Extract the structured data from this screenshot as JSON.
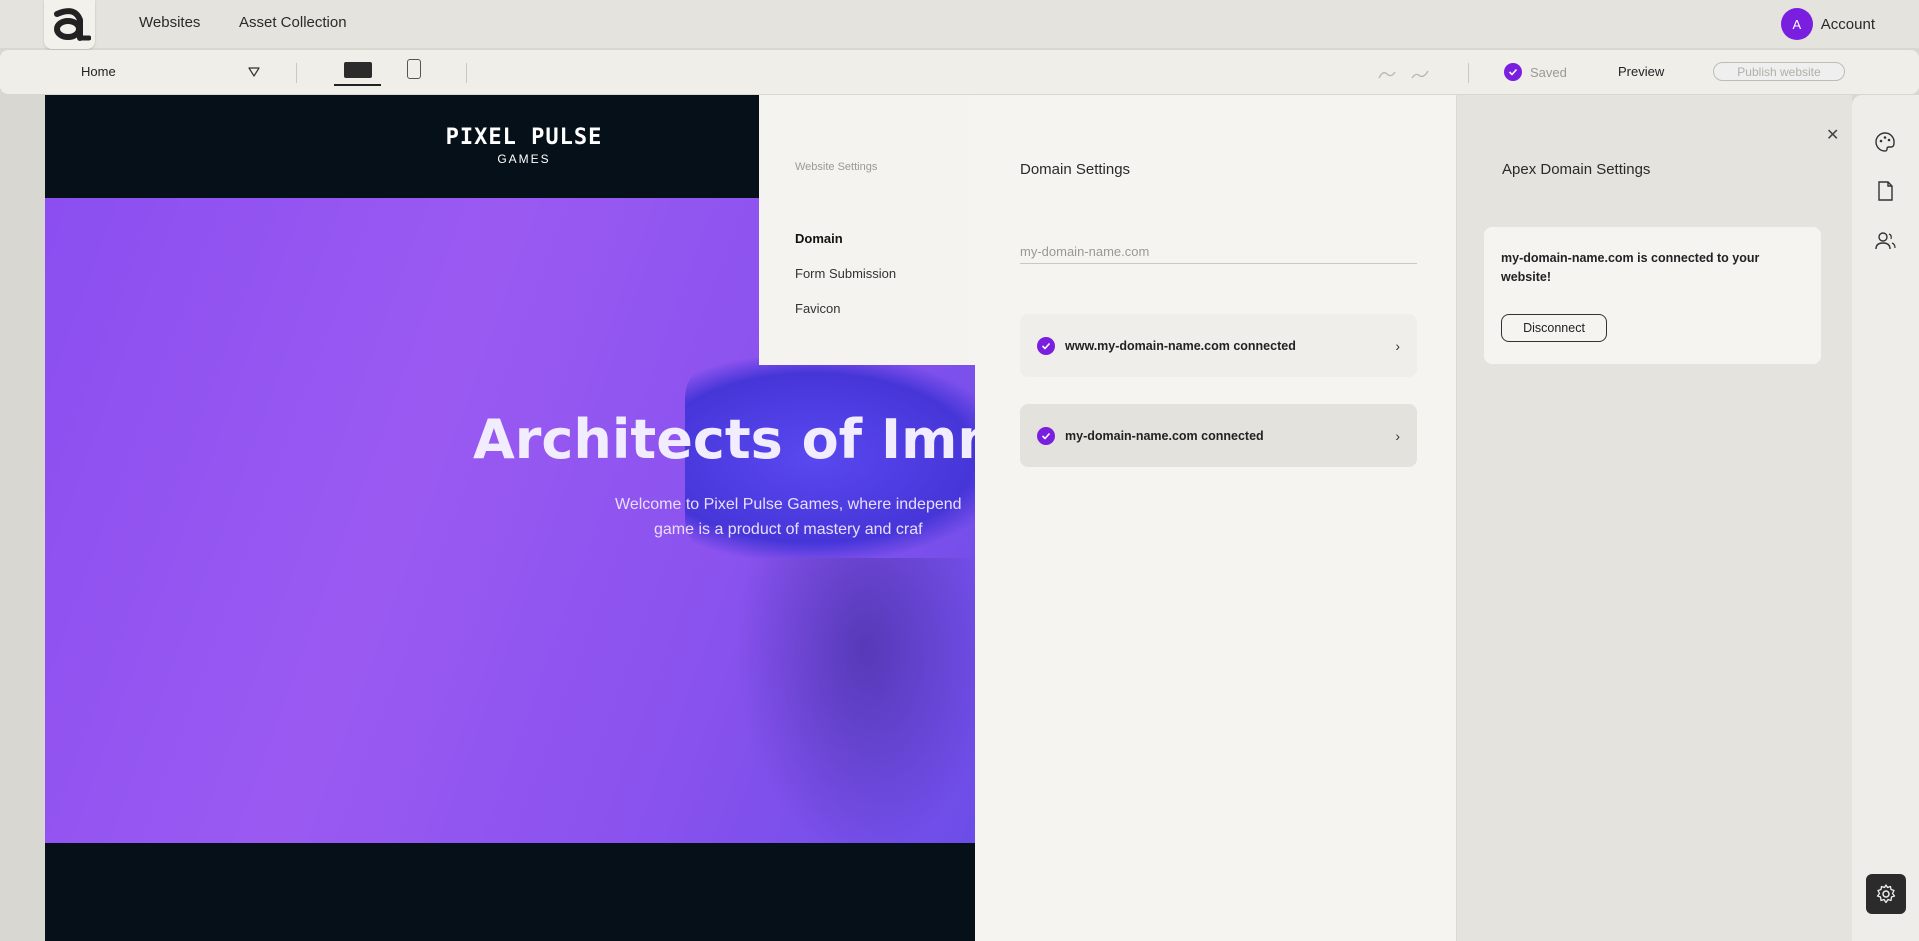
{
  "nav": {
    "links": [
      "Websites",
      "Asset Collection"
    ],
    "account_label": "Account",
    "avatar_initial": "A"
  },
  "toolbar": {
    "page_selected": "Home",
    "saved_label": "Saved",
    "preview_label": "Preview",
    "publish_label": "Publish website"
  },
  "site": {
    "brand_name": "PIXEL PULSE",
    "brand_sub": "GAMES",
    "hero_title": "Architects of Imm",
    "hero_line1": "Welcome to Pixel Pulse Games, where independ",
    "hero_line2": "game is a product of mastery and craf"
  },
  "settings_menu": {
    "heading": "Website Settings",
    "items": [
      "Domain",
      "Form Submission",
      "Favicon"
    ],
    "active": "Domain"
  },
  "domain_settings": {
    "title": "Domain Settings",
    "input_placeholder": "my-domain-name.com",
    "connections": [
      {
        "label": "www.my-domain-name.com connected"
      },
      {
        "label": "my-domain-name.com connected"
      }
    ]
  },
  "apex": {
    "title": "Apex Domain Settings",
    "message": "my-domain-name.com is connected to your website!",
    "disconnect_label": "Disconnect"
  },
  "colors": {
    "accent": "#7a1ee0",
    "hero_purple": "#9a5af2",
    "site_dark": "#061018"
  },
  "icons": [
    "logo-a-icon",
    "chevron-down-icon",
    "desktop-icon",
    "mobile-icon",
    "undo-icon",
    "redo-icon",
    "check-icon",
    "chevron-right-icon",
    "close-icon",
    "palette-icon",
    "page-icon",
    "users-icon",
    "gear-icon"
  ]
}
